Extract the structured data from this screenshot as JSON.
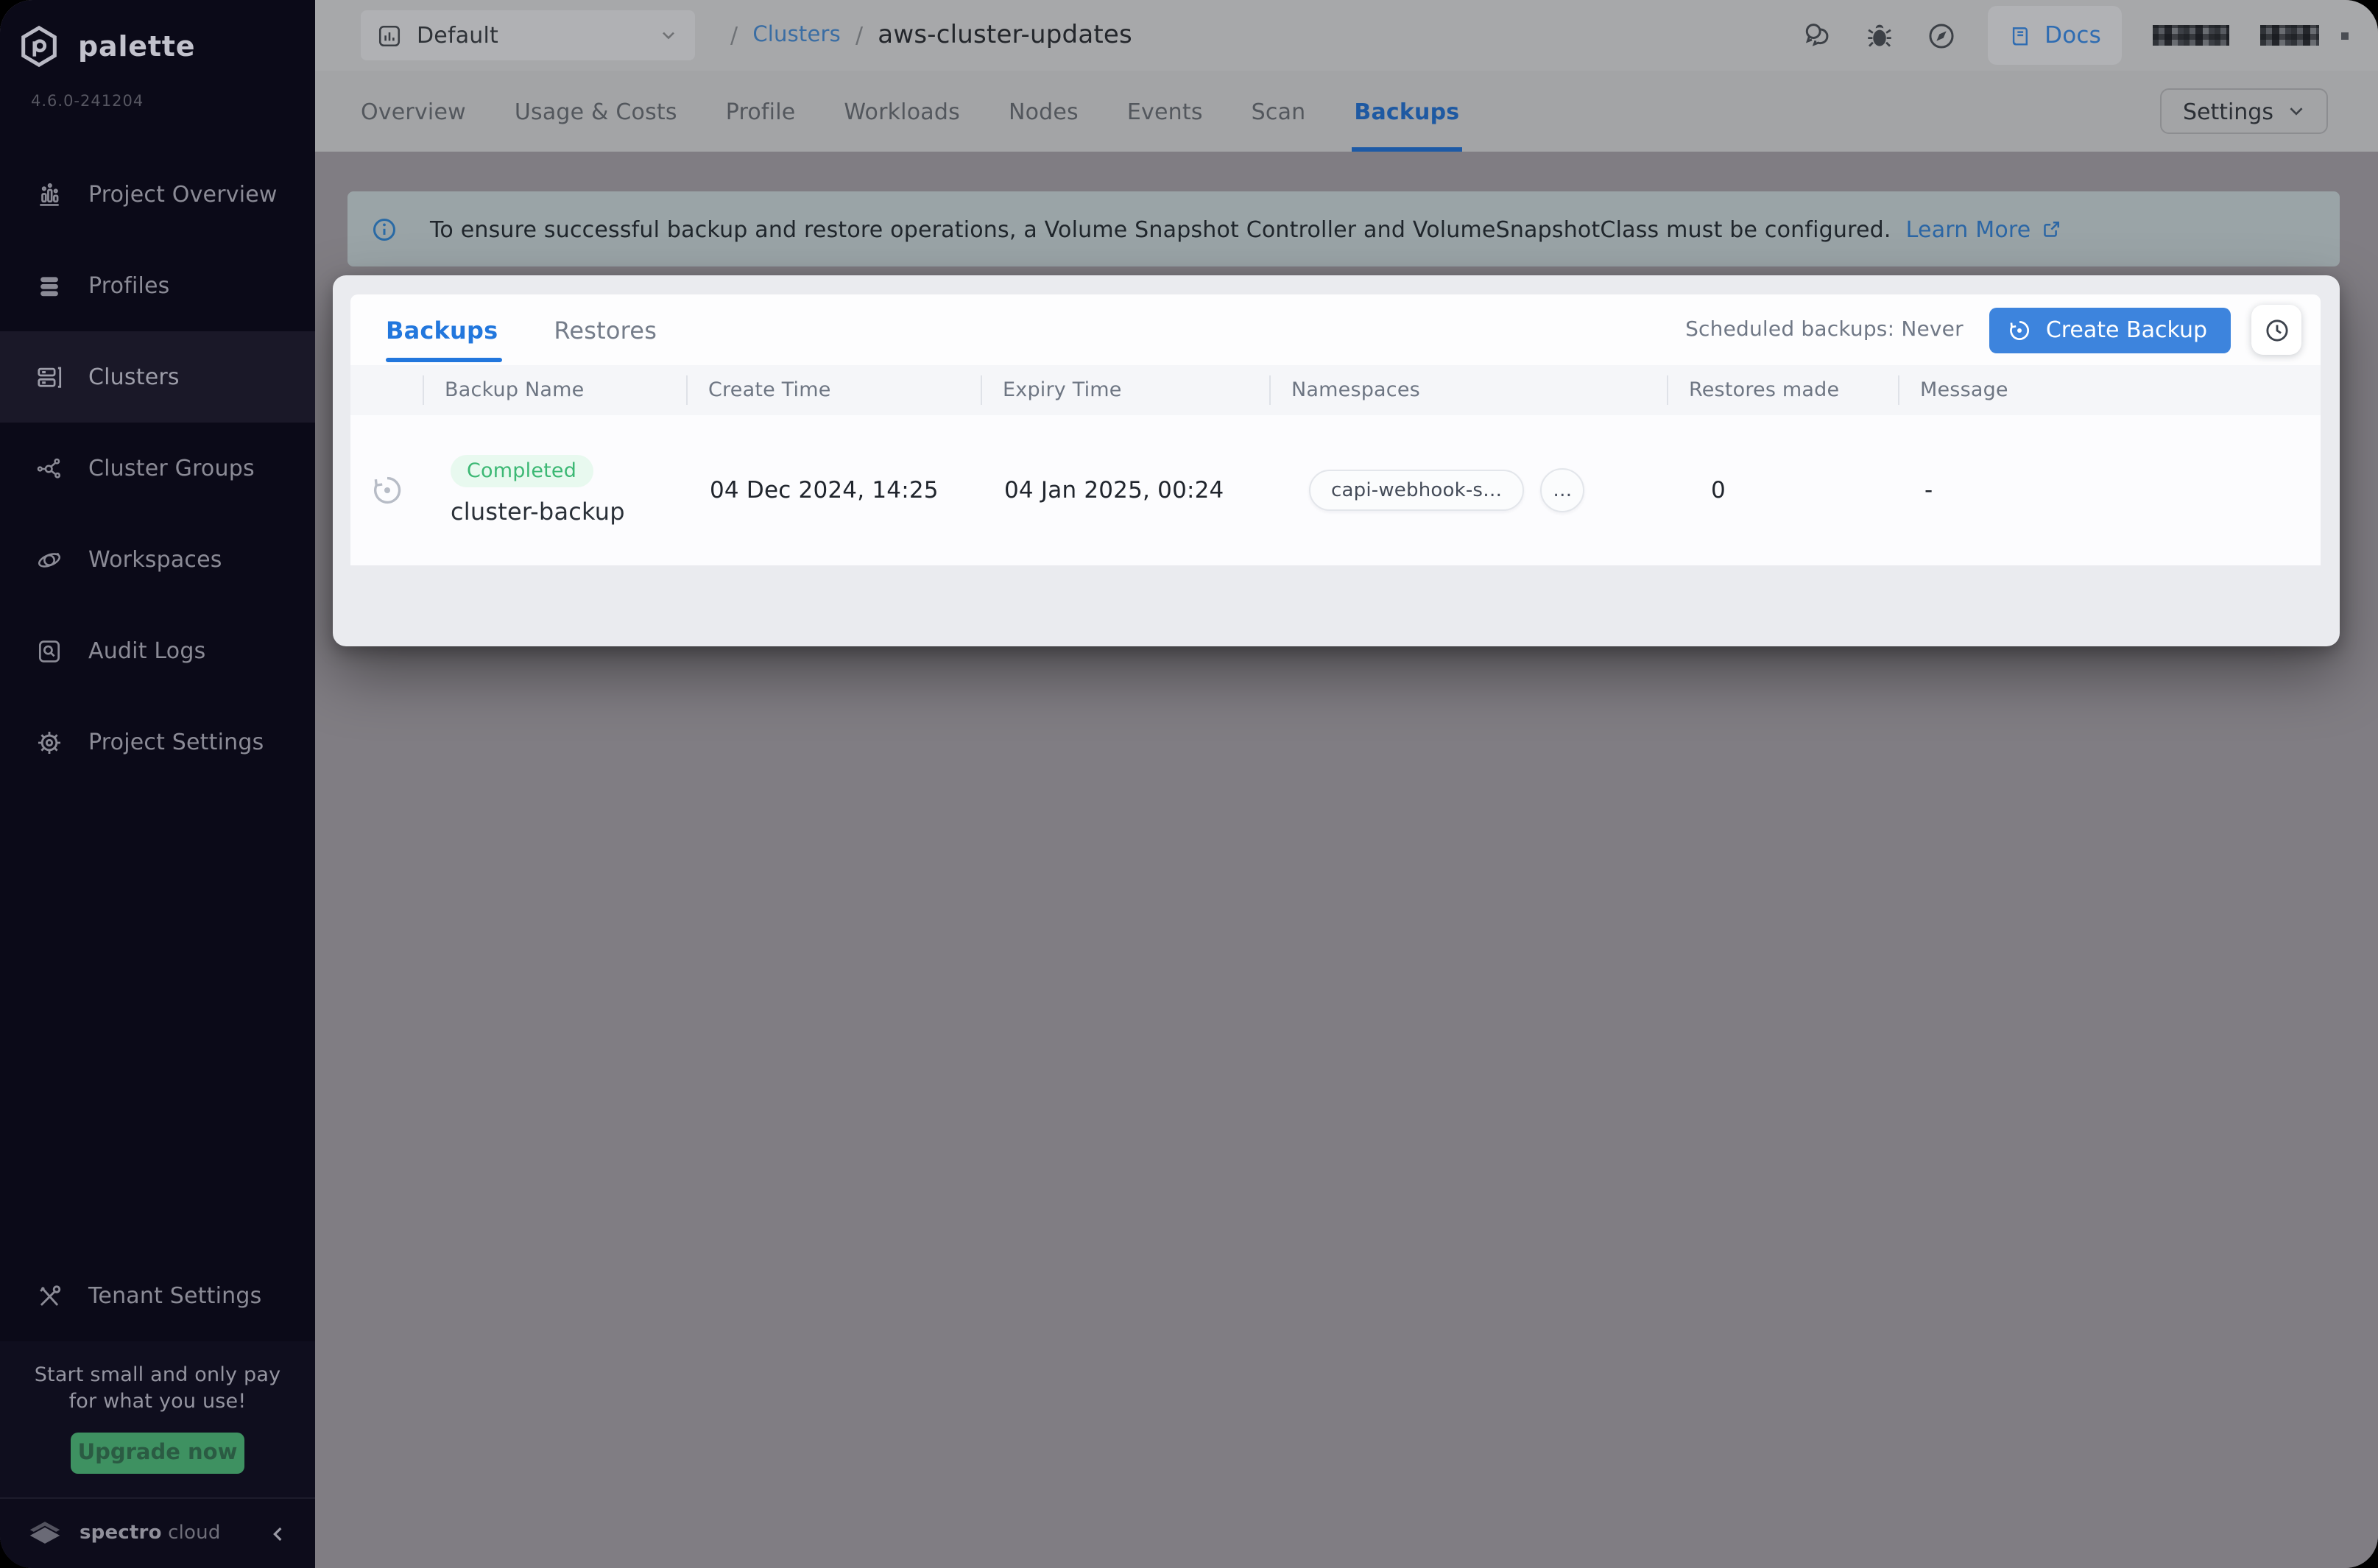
{
  "brand": {
    "logo_text": "palette",
    "version": "4.6.0-241204",
    "footer_brand_bold": "spectro",
    "footer_brand_light": "cloud"
  },
  "sidebar": {
    "items": [
      {
        "label": "Project Overview",
        "icon": "bar-chart-icon",
        "active": false
      },
      {
        "label": "Profiles",
        "icon": "layers-icon",
        "active": false
      },
      {
        "label": "Clusters",
        "icon": "servers-icon",
        "active": true
      },
      {
        "label": "Cluster Groups",
        "icon": "network-icon",
        "active": false
      },
      {
        "label": "Workspaces",
        "icon": "orbit-icon",
        "active": false
      },
      {
        "label": "Audit Logs",
        "icon": "audit-icon",
        "active": false
      },
      {
        "label": "Project Settings",
        "icon": "gear-icon",
        "active": false
      }
    ],
    "tenant_settings_label": "Tenant Settings",
    "promo": {
      "line1": "Start small and only pay",
      "line2": "for what you use!",
      "button": "Upgrade now"
    }
  },
  "topbar": {
    "project_selector": "Default",
    "breadcrumb": {
      "separator": "/",
      "link": "Clusters",
      "current": "aws-cluster-updates"
    },
    "docs_label": "Docs"
  },
  "cluster_tabs": {
    "items": [
      "Overview",
      "Usage & Costs",
      "Profile",
      "Workloads",
      "Nodes",
      "Events",
      "Scan",
      "Backups"
    ],
    "active": "Backups",
    "settings_button": "Settings"
  },
  "banner": {
    "message": "To ensure successful backup and restore operations, a Volume Snapshot Controller and VolumeSnapshotClass must be configured.",
    "link_label": "Learn More"
  },
  "backups_panel": {
    "tabs": [
      {
        "label": "Backups",
        "active": true
      },
      {
        "label": "Restores",
        "active": false
      }
    ],
    "scheduled_text": "Scheduled backups: Never",
    "create_button_label": "Create Backup",
    "columns": [
      "Backup Name",
      "Create Time",
      "Expiry Time",
      "Namespaces",
      "Restores made",
      "Message"
    ],
    "rows": [
      {
        "status": "Completed",
        "name": "cluster-backup",
        "create_time": "04 Dec 2024, 14:25",
        "expiry_time": "04 Jan 2025, 00:24",
        "namespace_chip": "capi-webhook-s…",
        "more_chip": "…",
        "restores_made": "0",
        "message": "-"
      }
    ]
  },
  "icons": [
    "palette-logo-icon",
    "bar-chart-icon",
    "layers-icon",
    "servers-icon",
    "network-icon",
    "orbit-icon",
    "audit-icon",
    "gear-icon",
    "tools-icon",
    "spectro-logo-icon",
    "chevron-left-icon",
    "chart-select-icon",
    "chevron-down-icon",
    "chat-icon",
    "bug-icon",
    "compass-icon",
    "book-icon",
    "info-icon",
    "external-link-icon",
    "history-icon",
    "clock-icon"
  ],
  "colors": {
    "accent_blue": "#2277dd",
    "success_green": "#3cb874",
    "upgrade_green": "#3e9161",
    "sidebar_bg": "#0b0a18",
    "dim_overlay_gray": "#807d83"
  }
}
